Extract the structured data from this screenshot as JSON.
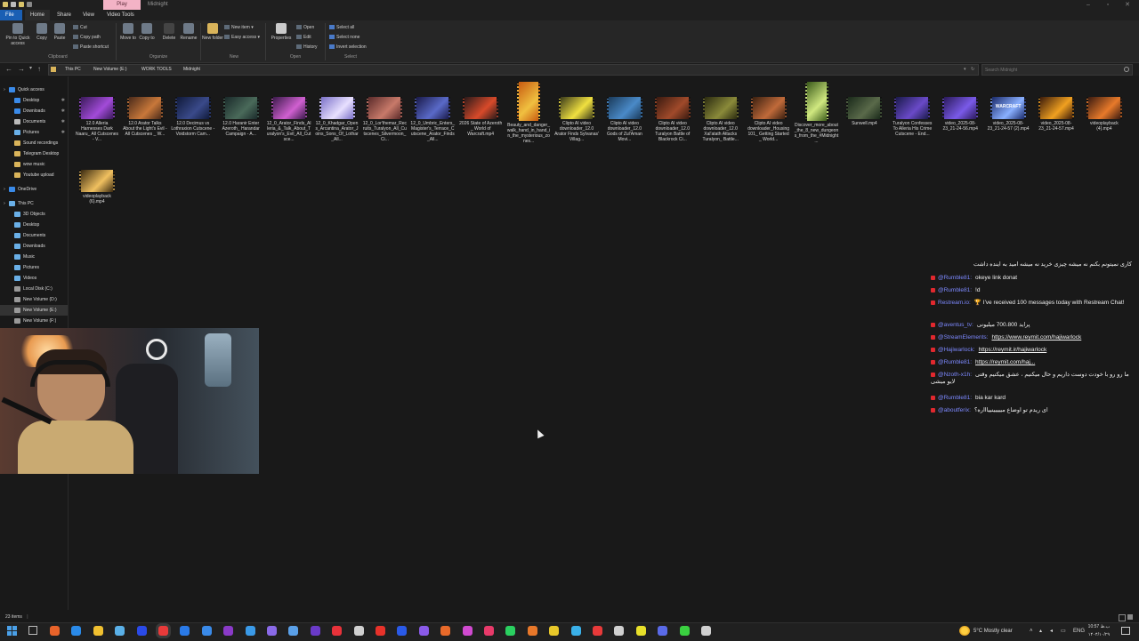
{
  "title_bar": {
    "context_tab": "Play",
    "window_title": "Midnight"
  },
  "ribbon": {
    "tabs": [
      "File",
      "Home",
      "Share",
      "View",
      "Video Tools"
    ],
    "clipboard": {
      "pin": "Pin to Quick access",
      "copy": "Copy",
      "paste": "Paste",
      "cut": "Cut",
      "copy_path": "Copy path",
      "paste_shortcut": "Paste shortcut",
      "group": "Clipboard"
    },
    "organize": {
      "move_to": "Move to",
      "copy_to": "Copy to",
      "delete": "Delete",
      "rename": "Rename",
      "group": "Organize"
    },
    "new": {
      "new_folder": "New folder",
      "new_item": "New item ▾",
      "easy_access": "Easy access ▾",
      "group": "New"
    },
    "open": {
      "properties": "Properties",
      "open": "Open",
      "edit": "Edit",
      "history": "History",
      "group": "Open"
    },
    "select": {
      "select_all": "Select all",
      "select_none": "Select none",
      "invert": "Invert selection",
      "group": "Select"
    }
  },
  "address": {
    "crumbs": [
      "This PC",
      "New Volume (E:)",
      "WORK TOOLS",
      "Midnight"
    ],
    "search_placeholder": "Search Midnight"
  },
  "nav": {
    "quick_access": "Quick access",
    "quick_items": [
      "Desktop",
      "Downloads",
      "Documents",
      "Pictures",
      "Sound recordings",
      "Telegram Desktop",
      "wow music",
      "Youtube upload"
    ],
    "onedrive": "OneDrive",
    "this_pc": "This PC",
    "pc_items": [
      "3D Objects",
      "Desktop",
      "Documents",
      "Downloads",
      "Music",
      "Pictures",
      "Videos",
      "Local Disk (C:)",
      "New Volume (D:)",
      "New Volume (E:)",
      "New Volume (F:)"
    ]
  },
  "files": [
    "12.0 Alleria Harnesses Dark Naaru_ All Cutscenes - V...",
    "12.0 Arator Talks About the Light's Evil - All Cutscenes _ W...",
    "12.0 Decimus vs Lothraxion Cutscene - Voidstorm Cam...",
    "12.0 Haranir Enter Azeroth_ Harandar Campaign - A...",
    "12_0_Arator_Finds_Alleria_&_Talk_About_Turalyon's_Evil_All_Cutsce...",
    "12_0_Khadgar_Opens_Arcantina_Arator_Joins_Sons_Of_Lothar_All...",
    "12_0_Lor'themar_Recruits_Turalyon_All_Cutscenes_Silvermoon_Ci...",
    "12_0_Umbric_Enters_Magister's_Terrace_Cutscene_Arator_Finds_All...",
    "2026 State of Azeroth _ World of Warcraft.mp4",
    "Beauty_and_danger_walk_hand_in_hand_in_the_mysterious_zones...",
    "Clipto AI video downloader_12.0 Arator Finds Sylvanas' Villag...",
    "Clipto AI video downloader_12.0 Gods of Zul'Aman Movi...",
    "Clipto AI video downloader_12.0 Turalyon Battle of Blackrock Ci...",
    "Clipto AI video downloader_12.0 Xal'atath Attacks Turalyon_ Battle...",
    "Clipto AI video downloader_Housing 101_ Getting Started _ World...",
    "Discover_more_about_the_8_new_dungeons_from_the_#Midnight...",
    "Sunwell.mp4",
    "Turalyon Confesses To Alleria His Crime Cutscene - End...",
    "video_2025-08-23_21-24-56.mp4",
    "video_2025-08-23_21-24-57 (2).mp4",
    "video_2025-08-23_21-24-57.mp4",
    "videoplayback (4).mp4",
    "videoplayback (6).mp4"
  ],
  "thumb_colors": [
    [
      "#3a1a5a",
      "#a24bd8"
    ],
    [
      "#4a2a1a",
      "#c8783a"
    ],
    [
      "#101a3a",
      "#3a4a8a"
    ],
    [
      "#1a2a2a",
      "#4a6a5a"
    ],
    [
      "#3a1a4a",
      "#d060d0"
    ],
    [
      "#7a70c8",
      "#e8e0ff"
    ],
    [
      "#5a2a2a",
      "#c87a6a"
    ],
    [
      "#1a1a4a",
      "#5a6ac8"
    ],
    [
      "#2a1a1a",
      "#d84a2a"
    ],
    [
      "#c85a10",
      "#f0c040"
    ],
    [
      "#3a3a1a",
      "#f0e040"
    ],
    [
      "#1a3a5a",
      "#4a8ac8"
    ],
    [
      "#3a1a10",
      "#a04a2a"
    ],
    [
      "#2a2a10",
      "#8a8a3a"
    ],
    [
      "#3a2010",
      "#c06a3a"
    ],
    [
      "#3a5a1a",
      "#d0e880"
    ],
    [
      "#1a2a1a",
      "#5a6a4a"
    ],
    [
      "#1a1a4a",
      "#6a4ac8"
    ],
    [
      "#2a1a5a",
      "#7a5ae8"
    ],
    [
      "#1a2a6a",
      "#8ab0ff"
    ],
    [
      "#3a1a0a",
      "#f0a020"
    ],
    [
      "#3a1a10",
      "#e87a2a"
    ],
    [
      "#3a2a10",
      "#f0c060"
    ]
  ],
  "thumb_label": "WARCRAFT",
  "chat": [
    {
      "user": "",
      "text": "کاری نمیتونم بکنم نه میشه چیزی خرید نه میشه امید به اینده داشت",
      "rtl": true
    },
    {
      "user": "@Rumble81:",
      "text": "okeye link donat"
    },
    {
      "user": "@Rumble81:",
      "text": "!d"
    },
    {
      "user": "Restream.io:",
      "text": "🏆 I've received 100 messages today with Restream Chat!"
    },
    {
      "user": "@aventus_tv:",
      "text": "پراید 700.800 میلیونی"
    },
    {
      "user": "@StreamElements:",
      "link": "https://www.reymit.com/hajiwarlock"
    },
    {
      "user": "@Hajiwarlock:",
      "link": "https://reymit.ir/hajiwarlock"
    },
    {
      "user": "@Rumble81:",
      "link": "https://reymit.com/haj..."
    },
    {
      "user": "@Nzoth-x1h:",
      "text": "ما رو رو با خودت دوست داریم و حال میکنیم ، عشق میکنیم وقتی لایو میشی"
    },
    {
      "user": "@Rumble81:",
      "text": "bia kar kard"
    },
    {
      "user": "@aboutferix:",
      "text": "ای ریدم تو اوضاع مییییینییاااره؟"
    }
  ],
  "status": {
    "item_count": "23 items"
  },
  "tray": {
    "weather": "5°C  Mostly clear",
    "lang": "ENG",
    "time": "10:57 ب.ظ",
    "date": "۱۴۰۴/۱۰/۲۹"
  },
  "taskbar_colors": [
    "#e8632a",
    "#2a8ae8",
    "#f0c030",
    "#5ab0e8",
    "#2a4ae8",
    "#e83a3a",
    "#2a7ae8",
    "#3a8ae8",
    "#8a3ac8",
    "#3a9ae8",
    "#8a6ae8",
    "#5aa0e8",
    "#6a3ac8",
    "#e8323a",
    "#d0d0d0",
    "#e8322a",
    "#2a5ae8",
    "#8a5ae8",
    "#e86a2a",
    "#d04ad0",
    "#e83a6a",
    "#2ad060",
    "#e8782a",
    "#e8c82a",
    "#3ab0e8",
    "#e83a3a",
    "#d0d0d0",
    "#e8e02a",
    "#5a6ae8",
    "#3ad040",
    "#d0d0d0"
  ]
}
